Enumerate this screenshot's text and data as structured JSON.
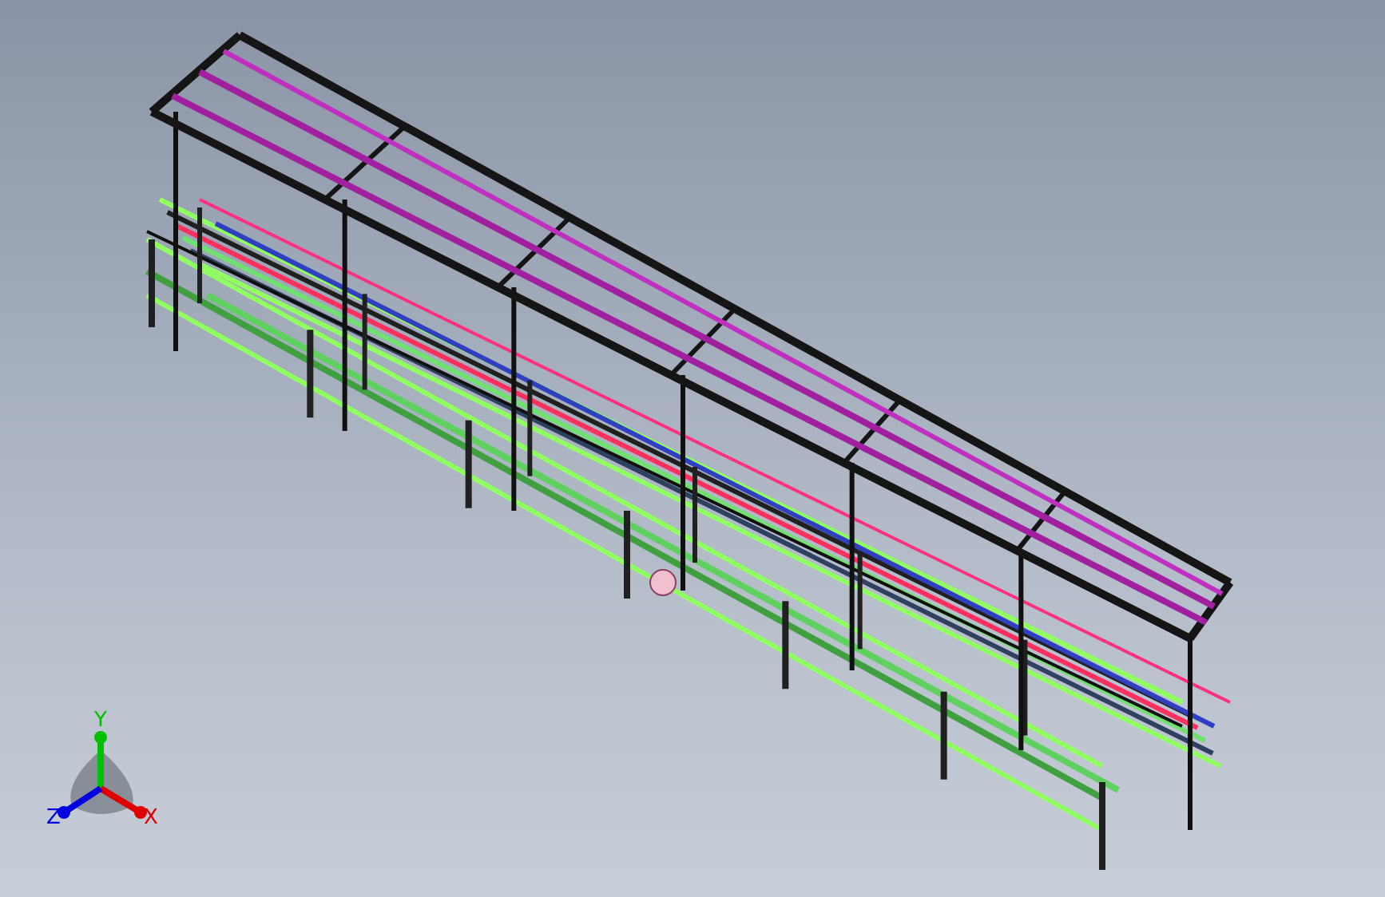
{
  "viewport": {
    "triad": {
      "axes": [
        {
          "label": "Y",
          "kind": "y",
          "color": "#00c000"
        },
        {
          "label": "X",
          "kind": "x",
          "color": "#e00000"
        },
        {
          "label": "Z",
          "kind": "z",
          "color": "#0000e0"
        }
      ]
    }
  }
}
